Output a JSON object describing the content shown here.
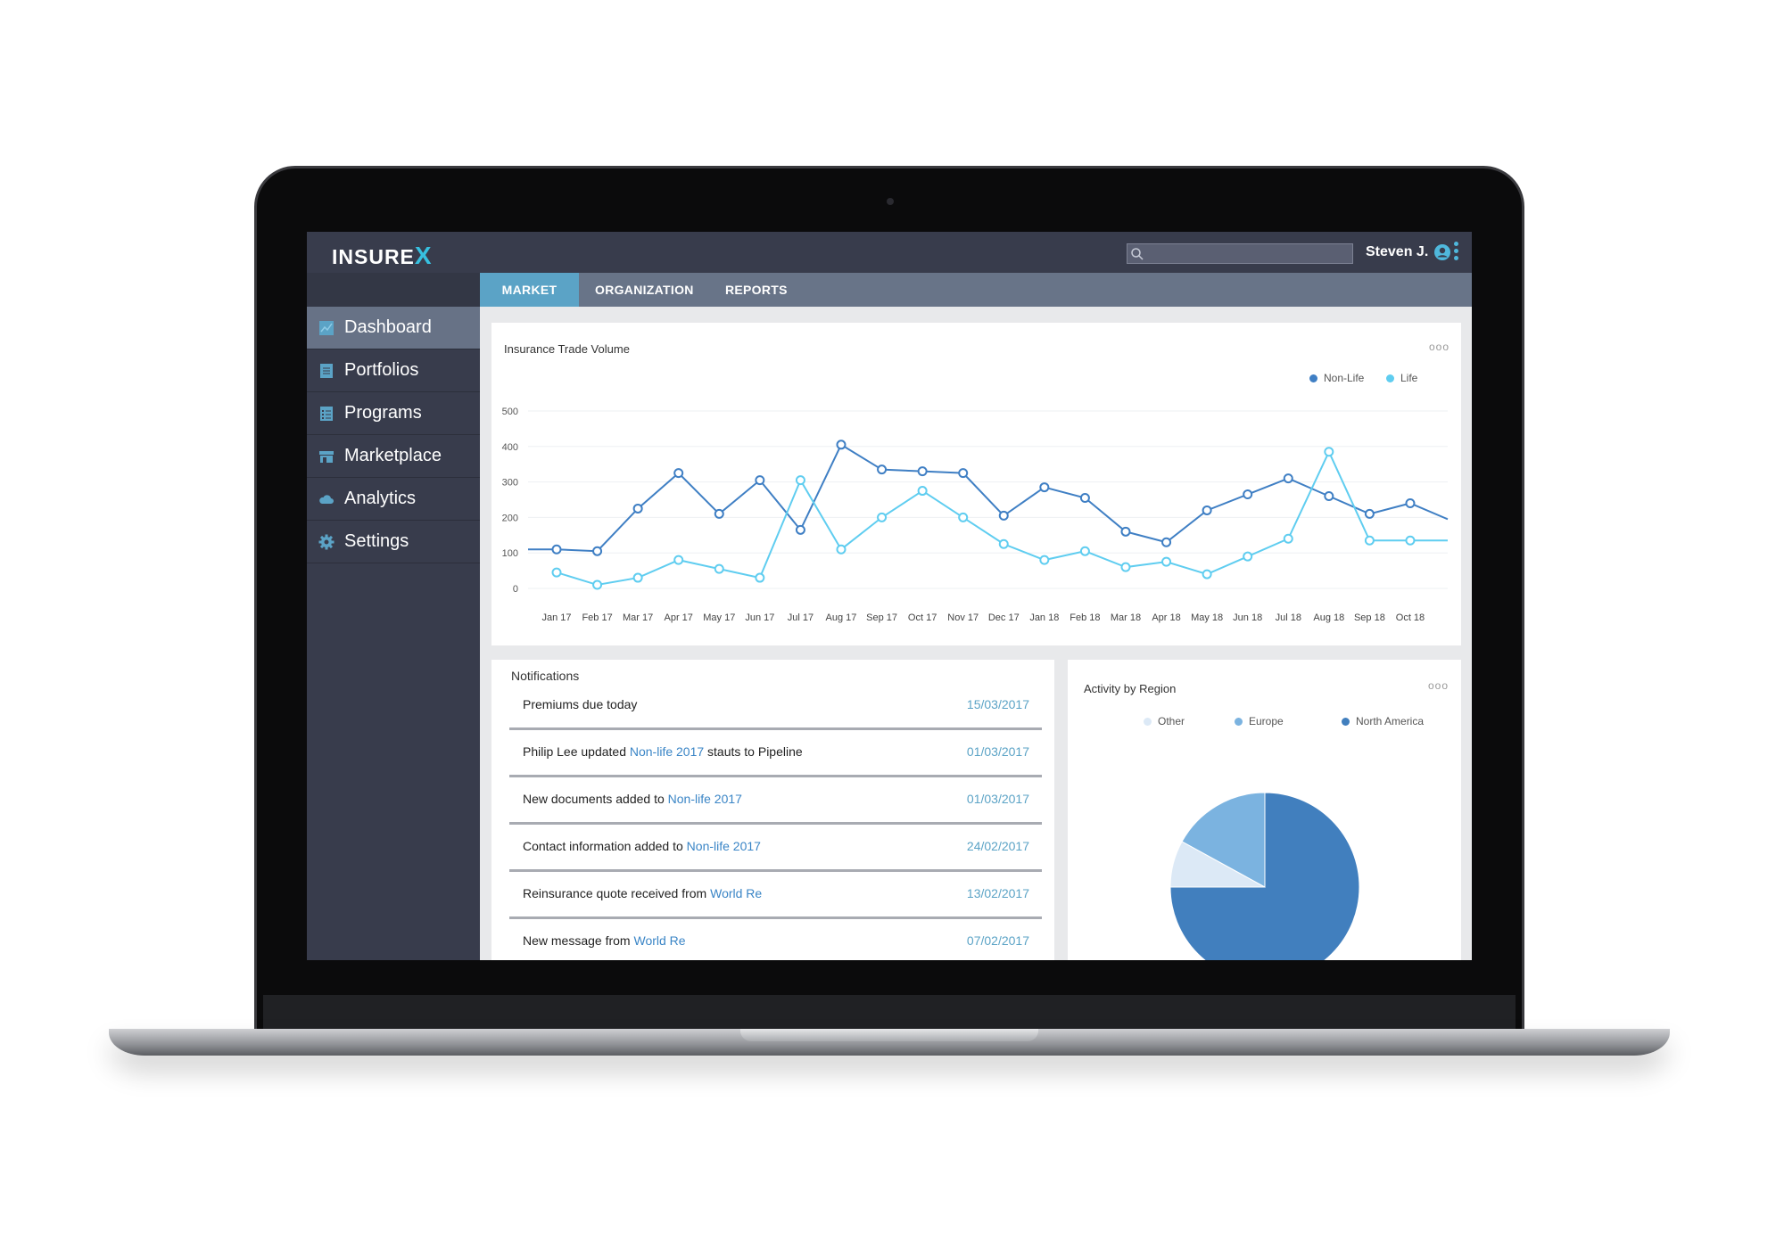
{
  "header": {
    "logo": "INSUREX",
    "logo_main": "INSURE",
    "logo_x": "X",
    "search_placeholder": "",
    "user_name": "Steven J."
  },
  "tabs": [
    {
      "label": "MARKET",
      "active": true
    },
    {
      "label": "ORGANIZATION"
    },
    {
      "label": "REPORTS"
    }
  ],
  "sidebar": {
    "items": [
      {
        "label": "Dashboard",
        "icon": "chart-icon",
        "active": true
      },
      {
        "label": "Portfolios",
        "icon": "document-icon"
      },
      {
        "label": "Programs",
        "icon": "list-icon"
      },
      {
        "label": "Marketplace",
        "icon": "store-icon"
      },
      {
        "label": "Analytics",
        "icon": "cloud-icon"
      },
      {
        "label": "Settings",
        "icon": "gear-icon"
      }
    ]
  },
  "colors": {
    "nonlife": "#3f7fc4",
    "life": "#5fcdf0",
    "accent": "#5ba3c6",
    "other": "#dce9f6",
    "europe": "#7bb3e0",
    "north_america": "#417fbe"
  },
  "chart_data": [
    {
      "type": "line",
      "title": "Insurance Trade Volume",
      "menu": "ooo",
      "categories": [
        "Jan 17",
        "Feb 17",
        "Mar 17",
        "Apr 17",
        "May 17",
        "Jun 17",
        "Jul 17",
        "Aug 17",
        "Sep 17",
        "Oct 17",
        "Nov 17",
        "Dec 17",
        "Jan 18",
        "Feb 18",
        "Mar 18",
        "Apr 18",
        "May 18",
        "Jun 18",
        "Jul 18",
        "Aug 18",
        "Sep 18",
        "Oct 18"
      ],
      "ylim": [
        0,
        500
      ],
      "yticks": [
        0,
        100,
        200,
        300,
        400,
        500
      ],
      "grid": true,
      "legend": "top-right",
      "series": [
        {
          "name": "Non-Life",
          "start": 110,
          "end": 195,
          "values": [
            110,
            105,
            225,
            325,
            210,
            305,
            165,
            405,
            335,
            330,
            325,
            205,
            285,
            255,
            160,
            130,
            220,
            265,
            310,
            260,
            210,
            240
          ]
        },
        {
          "name": "Life",
          "end": 135,
          "values": [
            45,
            10,
            30,
            80,
            55,
            30,
            305,
            110,
            200,
            275,
            200,
            125,
            80,
            105,
            60,
            75,
            40,
            90,
            140,
            385,
            135,
            135
          ]
        }
      ]
    },
    {
      "type": "pie",
      "title": "Activity by Region",
      "menu": "ooo",
      "legend": "top",
      "slices": [
        {
          "name": "Other",
          "value": 8
        },
        {
          "name": "Europe",
          "value": 17
        },
        {
          "name": "North America",
          "value": 75
        }
      ]
    }
  ],
  "notifications": {
    "title": "Notifications",
    "items": [
      {
        "text": "Premiums due today",
        "link": "",
        "after": "",
        "date": "15/03/2017"
      },
      {
        "text": "Philip Lee updated ",
        "link": "Non-life 2017",
        "after": " stauts to Pipeline",
        "date": "01/03/2017"
      },
      {
        "text": "New documents added to ",
        "link": "Non-life 2017",
        "after": "",
        "date": "01/03/2017"
      },
      {
        "text": "Contact information added to ",
        "link": "Non-life 2017",
        "after": "",
        "date": "24/02/2017"
      },
      {
        "text": "Reinsurance quote received from ",
        "link": "World Re",
        "after": "",
        "date": "13/02/2017"
      },
      {
        "text": "New message from ",
        "link": "World Re",
        "after": "",
        "date": "07/02/2017"
      }
    ]
  }
}
